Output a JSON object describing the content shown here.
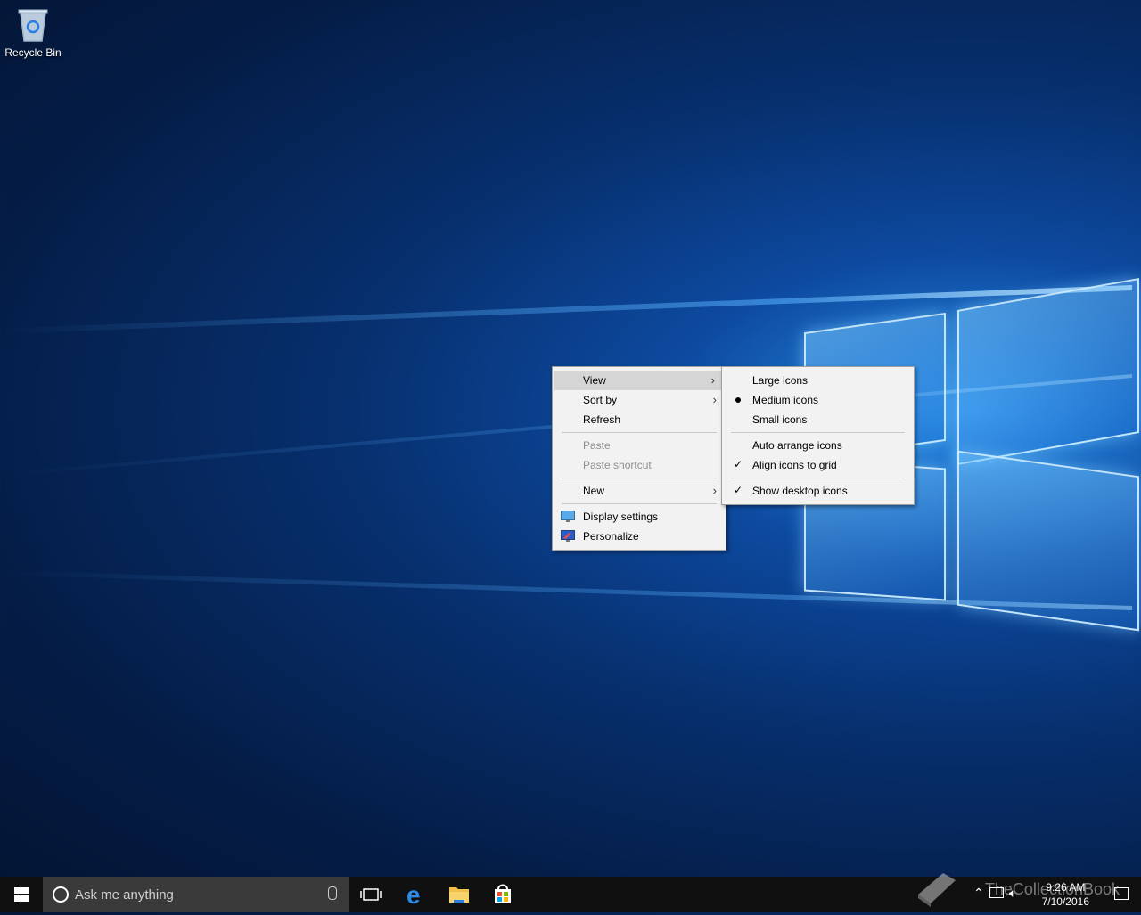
{
  "desktop": {
    "icons": [
      {
        "label": "Recycle Bin",
        "icon": "recycle-bin-icon"
      }
    ]
  },
  "context_menu": {
    "items": [
      {
        "label": "View",
        "submenu": true,
        "highlighted": true
      },
      {
        "label": "Sort by",
        "submenu": true
      },
      {
        "label": "Refresh"
      },
      {
        "label": "Paste",
        "disabled": true
      },
      {
        "label": "Paste shortcut",
        "disabled": true
      },
      {
        "label": "New",
        "submenu": true
      },
      {
        "label": "Display settings",
        "icon": "display-settings-icon"
      },
      {
        "label": "Personalize",
        "icon": "personalize-icon"
      }
    ]
  },
  "view_submenu": {
    "items": [
      {
        "label": "Large icons"
      },
      {
        "label": "Medium icons",
        "selected": true
      },
      {
        "label": "Small icons"
      },
      {
        "label": "Auto arrange icons"
      },
      {
        "label": "Align icons to grid",
        "checked": true
      },
      {
        "label": "Show desktop icons",
        "checked": true
      }
    ]
  },
  "taskbar": {
    "search_placeholder": "Ask me anything",
    "pinned": [
      "task-view-icon",
      "edge-icon",
      "file-explorer-icon",
      "store-icon"
    ],
    "clock_time": "9:26 AM",
    "clock_date": "7/10/2016",
    "watermark": "TheCollectionBook"
  },
  "colors": {
    "menu_bg": "#f2f2f2",
    "menu_highlight": "#d5d5d5",
    "taskbar_bg": "#101010",
    "search_bg": "#3a3a3a",
    "accent": "#1e88e5"
  }
}
